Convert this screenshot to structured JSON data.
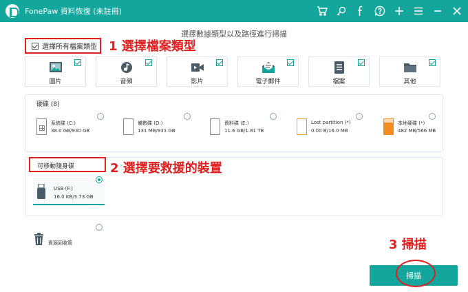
{
  "app": {
    "title": "FonePaw 資料恢復 (未註冊)"
  },
  "toolbar_icons": [
    "cart-icon",
    "key-icon",
    "facebook-icon",
    "help-icon",
    "plus-icon",
    "menu-icon",
    "minimize-icon",
    "close-icon"
  ],
  "subtitle": "選擇數據類型以及路徑進行掃描",
  "select_all": {
    "label": "選擇所有檔案類型",
    "checked": true
  },
  "annotations": {
    "step1": "1 選擇檔案類型",
    "step2": "2 選擇要救援的裝置",
    "step3": "3 掃描"
  },
  "file_types": [
    {
      "label": "圖片",
      "icon": "image-icon",
      "checked": true
    },
    {
      "label": "音頻",
      "icon": "music-icon",
      "checked": true
    },
    {
      "label": "影片",
      "icon": "video-icon",
      "checked": true
    },
    {
      "label": "電子郵件",
      "icon": "email-icon",
      "checked": true
    },
    {
      "label": "檔案",
      "icon": "document-icon",
      "checked": true
    },
    {
      "label": "其他",
      "icon": "folder-icon",
      "checked": true
    }
  ],
  "hard_disks": {
    "title": "硬碟 (8)",
    "drives": [
      {
        "name": "系統碟 (C:)",
        "size": "38.0 GB/930 GB",
        "selected": false
      },
      {
        "name": "備數碟 (D:)",
        "size": "131 MB/931 GB",
        "selected": false
      },
      {
        "name": "資料碟 (E:)",
        "size": "11.6 GB/1.81 TB",
        "selected": false
      },
      {
        "name": "Lost partition (*)",
        "size": "0.00  B/16.0 MB",
        "selected": false
      },
      {
        "name": "本地硬碟 (*)",
        "size": "482 MB/566 MB",
        "selected": false
      }
    ]
  },
  "removable": {
    "title": "可移動隨身碟",
    "devices": [
      {
        "name": "USB (F:)",
        "size": "16.0 KB/3.73 GB",
        "selected": true
      }
    ]
  },
  "recycle_bin": {
    "label": "資源回收筒",
    "selected": false
  },
  "scan": {
    "label": "掃描"
  },
  "colors": {
    "accent": "#13a69c",
    "annotation": "#e02020"
  }
}
